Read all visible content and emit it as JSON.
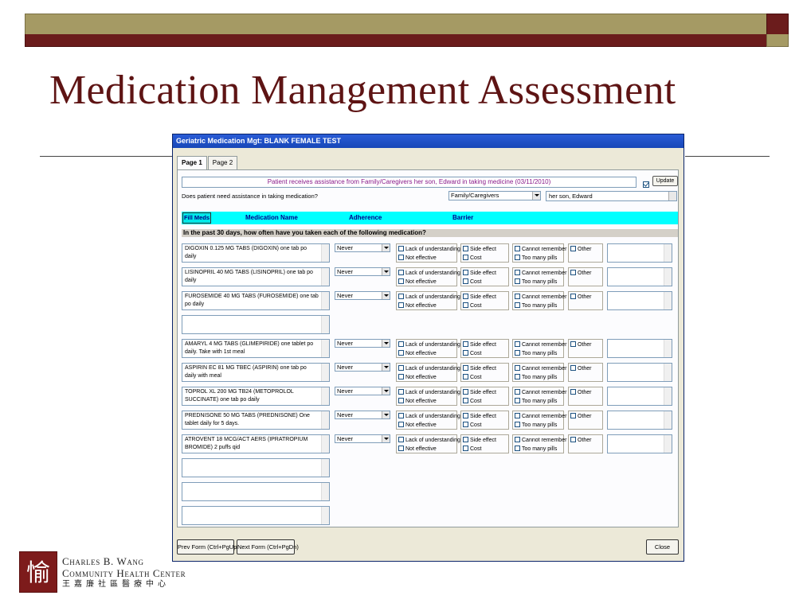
{
  "slide": {
    "title": "Medication Management Assessment",
    "logo": {
      "line1": "Charles B. Wang",
      "line2": "Community Health Center",
      "line3": "王嘉廉社區醫療中心",
      "mark_glyph": "愉"
    }
  },
  "window": {
    "title": "Geriatric Medication Mgt:  BLANK FEMALE TEST",
    "tabs": [
      {
        "label": "Page 1",
        "active": true
      },
      {
        "label": "Page 2",
        "active": false
      }
    ],
    "notice": "Patient receives assistance from Family/Caregivers her son, Edward in taking medicine  (03/11/2010)",
    "update": {
      "checked": true,
      "label": "Update"
    },
    "assistance": {
      "question": "Does patient need assistance in taking medication?",
      "selected": "Family/Caregivers",
      "detail": "her son, Edward"
    },
    "header": {
      "fill_button": "Fill Meds",
      "medication_name": "Medication Name",
      "adherence": "Adherence",
      "barrier": "Barrier"
    },
    "question": "In the past 30 days, how often have you taken each of the following medication?",
    "barrier_options": {
      "b1a": "Lack of understanding",
      "b1b": "Not effective",
      "b2a": "Side effect",
      "b2b": "Cost",
      "b3a": "Cannot remember",
      "b3b": "Too many pills",
      "b4a": "Other"
    },
    "medications": [
      {
        "text": "DIGOXIN 0.125 MG TABS (DIGOXIN) one tab po daily",
        "adherence": "Never"
      },
      {
        "text": "LISINOPRIL 40 MG TABS (LISINOPRIL) one tab po daily",
        "adherence": "Never"
      },
      {
        "text": "FUROSEMIDE 40 MG TABS (FUROSEMIDE) one tab po daily",
        "adherence": "Never"
      },
      {
        "text": "",
        "adherence": ""
      },
      {
        "text": "AMARYL 4 MG TABS (GLIMEPIRIDE) one tablet po daily. Take with 1st meal",
        "adherence": "Never"
      },
      {
        "text": "ASPIRIN EC 81 MG TBEC (ASPIRIN) one tab po daily with meal",
        "adherence": "Never"
      },
      {
        "text": "TOPROL XL 200 MG TB24 (METOPROLOL SUCCINATE) one tab po daily",
        "adherence": "Never"
      },
      {
        "text": "PREDNISONE 50 MG TABS (PREDNISONE) One tablet daily for 5 days.",
        "adherence": "Never"
      },
      {
        "text": "ATROVENT 18 MCG/ACT AERS (IPRATROPIUM BROMIDE) 2 puffs qid",
        "adherence": "Never"
      },
      {
        "text": "",
        "adherence": ""
      },
      {
        "text": "",
        "adherence": ""
      },
      {
        "text": "",
        "adherence": ""
      }
    ],
    "buttons": {
      "prev": "Prev Form (Ctrl+PgUp)",
      "next": "Next Form (Ctrl+PgDn)",
      "close": "Close"
    }
  }
}
